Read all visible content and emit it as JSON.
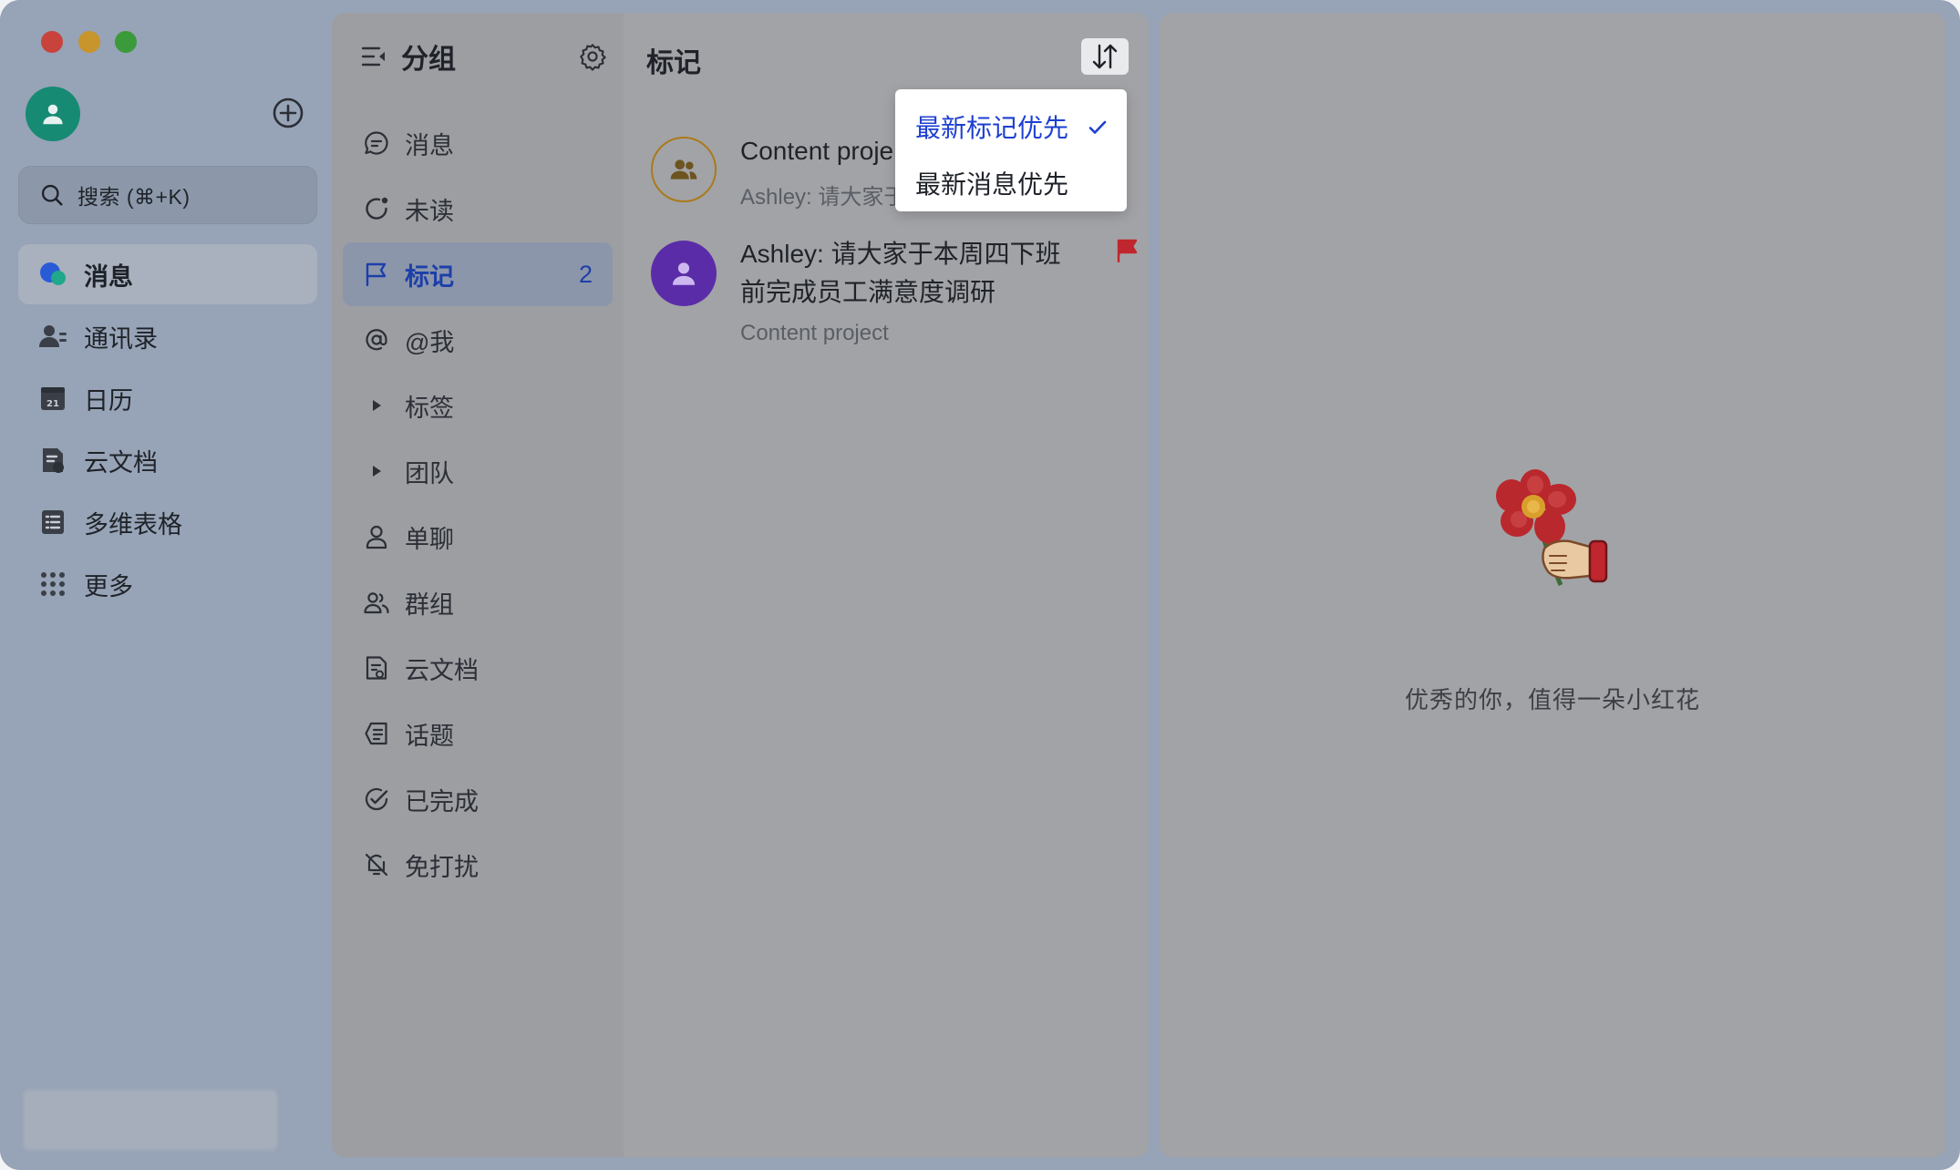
{
  "nav": {
    "search_placeholder": "搜索 (⌘+K)",
    "items": [
      {
        "label": "消息",
        "icon": "chat-bubble-icon",
        "active": true
      },
      {
        "label": "通讯录",
        "icon": "contacts-icon"
      },
      {
        "label": "日历",
        "icon": "calendar-icon",
        "badge": "21"
      },
      {
        "label": "云文档",
        "icon": "cloud-doc-icon"
      },
      {
        "label": "多维表格",
        "icon": "base-table-icon"
      },
      {
        "label": "更多",
        "icon": "more-grid-icon"
      }
    ]
  },
  "groups": {
    "title": "分组",
    "items": [
      {
        "label": "消息",
        "icon": "message-icon"
      },
      {
        "label": "未读",
        "icon": "unread-icon"
      },
      {
        "label": "标记",
        "icon": "flag-outline-icon",
        "count": "2",
        "active": true
      },
      {
        "label": "@我",
        "icon": "at-icon"
      },
      {
        "label": "标签",
        "icon": "caret-right-icon"
      },
      {
        "label": "团队",
        "icon": "caret-right-icon"
      },
      {
        "label": "单聊",
        "icon": "person-icon"
      },
      {
        "label": "群组",
        "icon": "group-icon"
      },
      {
        "label": "云文档",
        "icon": "doc-icon"
      },
      {
        "label": "话题",
        "icon": "topic-icon"
      },
      {
        "label": "已完成",
        "icon": "done-icon"
      },
      {
        "label": "免打扰",
        "icon": "mute-icon"
      }
    ]
  },
  "marked": {
    "title": "标记",
    "conversations": [
      {
        "name": "Content proje",
        "preview": "Ashley: 请大家于",
        "avatar": "group-avatar-icon"
      },
      {
        "message": "Ashley: 请大家于本周四下班前完成员工满意度调研",
        "sub": "Content project",
        "avatar": "person-avatar-icon",
        "flag_color": "#c0262d"
      }
    ]
  },
  "sort_menu": {
    "options": [
      {
        "label": "最新标记优先",
        "selected": true
      },
      {
        "label": "最新消息优先",
        "selected": false
      }
    ]
  },
  "empty_state": {
    "text": "优秀的你，值得一朵小红花"
  },
  "colors": {
    "accent": "#1d3fd1",
    "flag": "#c0262d",
    "avatar_green": "#168a73",
    "avatar_purple": "#5b2ca8"
  }
}
